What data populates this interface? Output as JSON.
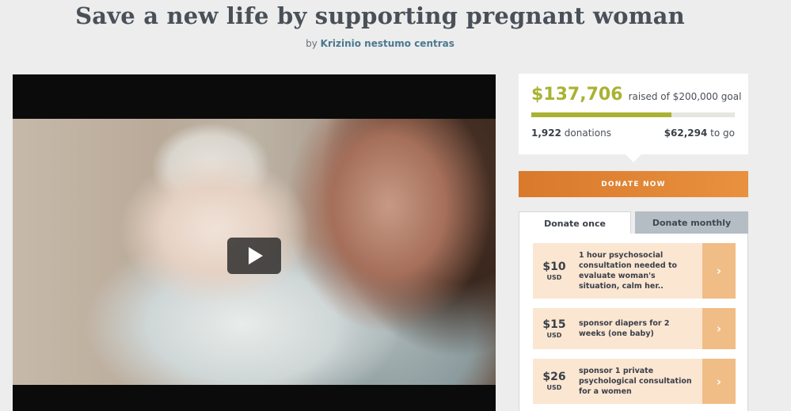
{
  "campaign": {
    "title": "Save a new life by supporting pregnant woman",
    "by_label": "by",
    "organizer": "Krizinio nestumo centras"
  },
  "video": {
    "play_icon": "play-icon"
  },
  "stats": {
    "raised": "$137,706",
    "raised_of_goal": "raised of $200,000 goal",
    "progress_fraction": 0.6885,
    "donations_count": "1,922",
    "donations_label": "donations",
    "to_go_amount": "$62,294",
    "to_go_label": "to go",
    "accent_color": "#a9b232"
  },
  "donate_button": {
    "label": "DONATE NOW",
    "color": "#e28637"
  },
  "tabs": {
    "once": "Donate once",
    "monthly": "Donate monthly"
  },
  "options": [
    {
      "amount": "$10",
      "currency": "USD",
      "description": "1 hour psychosocial consultation needed to evaluate woman's situation, calm her..",
      "arrow": "›"
    },
    {
      "amount": "$15",
      "currency": "USD",
      "description": "sponsor diapers for 2 weeks (one baby)",
      "arrow": "›"
    },
    {
      "amount": "$26",
      "currency": "USD",
      "description": "sponsor 1 private psychological consultation for a women",
      "arrow": "›"
    }
  ]
}
